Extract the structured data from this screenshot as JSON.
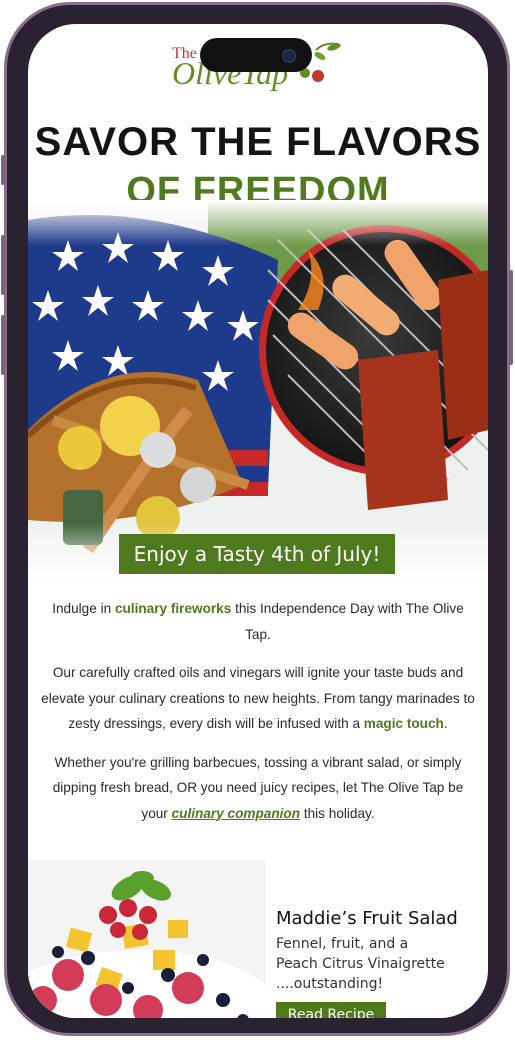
{
  "brand": {
    "logo_text_small": "The",
    "logo_text": "OliveTap"
  },
  "hero": {
    "headline_line1": "SAVOR THE FLAVORS",
    "headline_line2": "OF FREEDOM",
    "banner": "Enjoy a Tasty 4th of July!"
  },
  "body": {
    "p1_a": "Indulge in ",
    "p1_highlight": "culinary fireworks",
    "p1_b": " this Independence Day with The Olive Tap.",
    "p2_a": "Our carefully crafted oils and vinegars will ignite your taste buds and elevate your culinary creations to new heights. From tangy marinades to zesty dressings, every dish will be infused with a ",
    "p2_highlight": "magic touch",
    "p2_b": ".",
    "p3_a": "Whether you're grilling barbecues, tossing a vibrant salad, or simply dipping fresh bread, OR you need juicy recipes, let The Olive Tap be your ",
    "p3_link": "culinary companion",
    "p3_b": " this holiday."
  },
  "recipe": {
    "title": "Maddie’s Fruit Salad",
    "desc_line1": "Fennel, fruit, and a",
    "desc_line2": "Peach Citrus Vinaigrette",
    "desc_line3": "....outstanding!",
    "button": "Read Recipe"
  },
  "colors": {
    "accent_green": "#4e7a1d",
    "frame": "#8a6f8c",
    "logo_red": "#c0392b"
  }
}
